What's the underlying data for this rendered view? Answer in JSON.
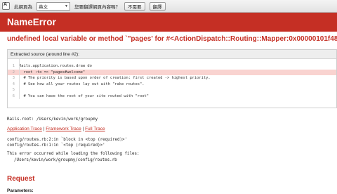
{
  "translate_bar": {
    "prefix": "此網頁為",
    "language": "英文",
    "question": "您要翻譯網頁內容嗎？",
    "no_button": "不需要",
    "translate_button": "翻譯"
  },
  "header": {
    "title": "NameError"
  },
  "error_message": "undefined local variable or method `\"pages' for #<ActionDispatch::Routing::Mapper:0x00000101f48470>",
  "source": {
    "title": "Extracted source (around line #2):",
    "lines": [
      {
        "no": "1",
        "text": "Rails.application.routes.draw do"
      },
      {
        "no": "2",
        "text": "  root :to => \"pages#welcome\""
      },
      {
        "no": "3",
        "text": "  # The priority is based upon order of creation: first created -> highest priority."
      },
      {
        "no": "4",
        "text": "  # See how all your routes lay out with \"rake routes\"."
      },
      {
        "no": "5",
        "text": ""
      },
      {
        "no": "6",
        "text": "  # You can have the root of your site routed with \"root\""
      }
    ]
  },
  "rails_root": "Rails.root: /Users/kevin/work/groupmy",
  "trace_links": {
    "application": "Application Trace",
    "framework": "Framework Trace",
    "full": "Full Trace",
    "separator": " | "
  },
  "trace_lines": [
    "config/routes.rb:2:in `block in <top (required)>'",
    "config/routes.rb:1:in `<top (required)>'"
  ],
  "loading": {
    "message": "This error occurred while loading the following files:",
    "file": "/Users/kevin/work/groupmy/config/routes.rb"
  },
  "request": {
    "title": "Request",
    "parameters_label": "Parameters:"
  }
}
